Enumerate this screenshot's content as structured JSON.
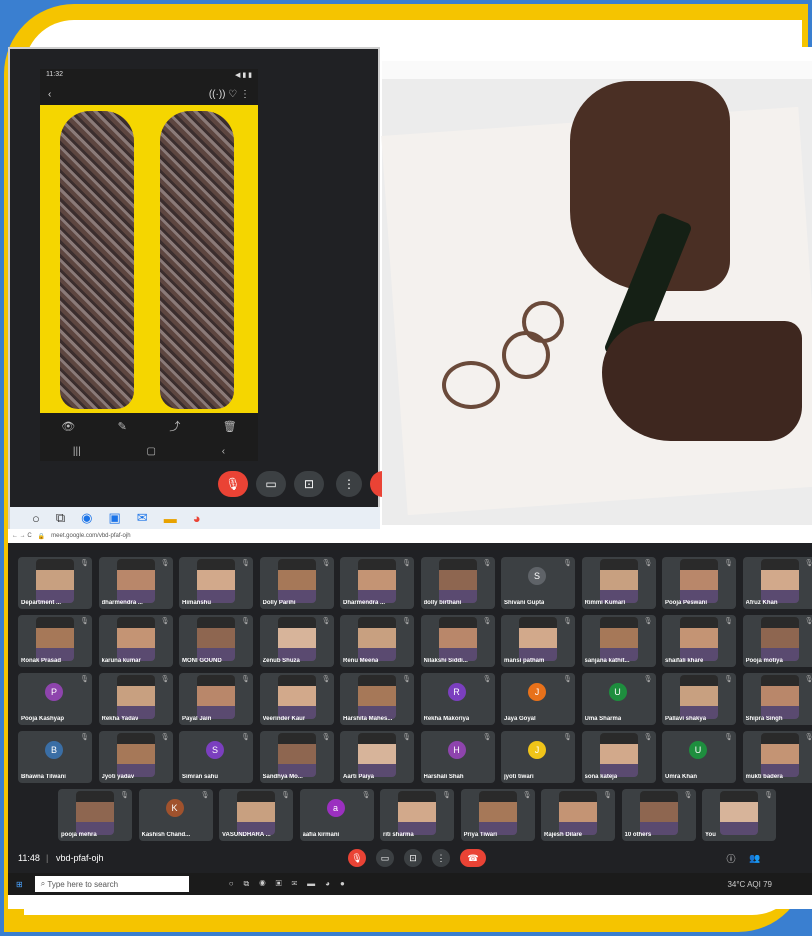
{
  "phone": {
    "status_time": "11:32",
    "status_right": "◀ ▮ ▮",
    "back": "‹",
    "top_icons": "((·))  ♡  ⋮",
    "actions": [
      "👁",
      "✎",
      "⤴",
      "🗑"
    ],
    "nav": [
      "|||",
      "▢",
      "‹"
    ]
  },
  "browser": {
    "url": "meet.google.com/vbd-pfaf-ojh"
  },
  "participants": [
    {
      "name": "Department ..."
    },
    {
      "name": "dharmendra ..."
    },
    {
      "name": "Himanshu"
    },
    {
      "name": "Dolly Parihi"
    },
    {
      "name": "Dharmendra ..."
    },
    {
      "name": "dolly birthani"
    },
    {
      "name": "Shivani Gupta",
      "initial": "S",
      "color": "#5f6368"
    },
    {
      "name": "Rimmi Kumari"
    },
    {
      "name": "Pooja Peswani"
    },
    {
      "name": "Afruz Khan"
    },
    {
      "name": "Ronak Prasad"
    },
    {
      "name": "karuna kumar"
    },
    {
      "name": "MONI GOUND"
    },
    {
      "name": "Zenub Shuza"
    },
    {
      "name": "Renu Meena"
    },
    {
      "name": "Nilakshi Siddi..."
    },
    {
      "name": "mansi patham"
    },
    {
      "name": "sanjana kathit..."
    },
    {
      "name": "shaifali khare"
    },
    {
      "name": "Pooja motiya"
    },
    {
      "name": "Pooja Kashyap",
      "initial": "P",
      "color": "#8e44ad"
    },
    {
      "name": "Rekha Yadav"
    },
    {
      "name": "Payal Jain"
    },
    {
      "name": "Veerinder Kaur"
    },
    {
      "name": "Harshita Mahes..."
    },
    {
      "name": "Rekha Makoriya",
      "initial": "R",
      "color": "#7b3fbf"
    },
    {
      "name": "Jaya Goyal",
      "initial": "J",
      "color": "#e8711a"
    },
    {
      "name": "Uma Sharma",
      "initial": "U",
      "color": "#1e8e3e"
    },
    {
      "name": "Pallavi shakya"
    },
    {
      "name": "Shipra Singh"
    },
    {
      "name": "Bhawna Tilwani",
      "initial": "B",
      "color": "#3a6ea5"
    },
    {
      "name": "Jyoti yadav"
    },
    {
      "name": "Simran sahu",
      "initial": "S",
      "color": "#7b3fbf"
    },
    {
      "name": "Sandhya Mo..."
    },
    {
      "name": "Aarti Paiya"
    },
    {
      "name": "Harshali Shah",
      "initial": "H",
      "color": "#8e44ad"
    },
    {
      "name": "jyoti tiwari",
      "initial": "J",
      "color": "#f0c419"
    },
    {
      "name": "sona kateja"
    },
    {
      "name": "Umra Khan",
      "initial": "U",
      "color": "#1e8e3e"
    },
    {
      "name": "mukti badera"
    },
    {
      "name": "pooja mehra"
    },
    {
      "name": "Kashish Chand...",
      "initial": "K",
      "color": "#a0522d"
    },
    {
      "name": "VASUNDHARA ..."
    },
    {
      "name": "aafia kirmani",
      "initial": "a",
      "color": "#9b30c0"
    },
    {
      "name": "riti sharma"
    },
    {
      "name": "Priya Tiwari"
    },
    {
      "name": "Rajesh Dilare"
    },
    {
      "name": "10 others"
    },
    {
      "name": "You"
    }
  ],
  "meeting": {
    "time": "11:48",
    "code": "vbd-pfaf-ojh",
    "divider": "|"
  },
  "taskbar": {
    "search_placeholder": "Type here to search",
    "weather": "34°C  AQI 79"
  }
}
